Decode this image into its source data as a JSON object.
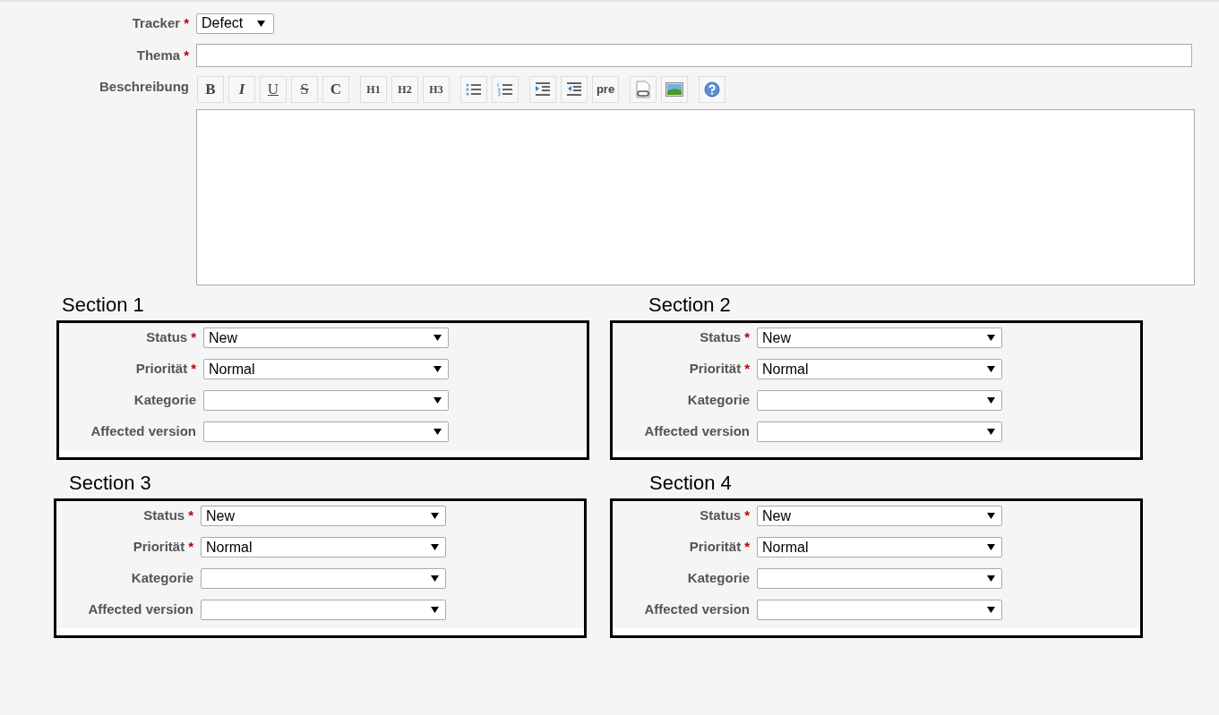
{
  "form": {
    "tracker": {
      "label": "Tracker",
      "mark": "*",
      "value": "Defect"
    },
    "subject": {
      "label": "Thema",
      "mark": "*"
    },
    "description": {
      "label": "Beschreibung",
      "toolbar": [
        [
          {
            "kind": "bold",
            "glyph": "B"
          },
          {
            "kind": "italic",
            "glyph": "I"
          },
          {
            "kind": "underline",
            "glyph": "U"
          },
          {
            "kind": "strike",
            "glyph": "S"
          },
          {
            "kind": "code",
            "glyph": "C"
          }
        ],
        [
          {
            "kind": "heading",
            "glyph": "H1"
          },
          {
            "kind": "heading",
            "glyph": "H2"
          },
          {
            "kind": "heading",
            "glyph": "H3"
          }
        ],
        [
          {
            "kind": "bullet-list"
          },
          {
            "kind": "numbered-list"
          }
        ],
        [
          {
            "kind": "indent-right"
          },
          {
            "kind": "indent-left"
          },
          {
            "kind": "pre",
            "glyph": "pre"
          }
        ],
        [
          {
            "kind": "link"
          },
          {
            "kind": "image"
          }
        ],
        [
          {
            "kind": "help"
          }
        ]
      ]
    }
  },
  "sections": [
    {
      "title": "Section 1",
      "fields": [
        {
          "label": "Status",
          "mark": "*",
          "value": "New"
        },
        {
          "label": "Priorität",
          "mark": "*",
          "value": "Normal"
        },
        {
          "label": "Kategorie"
        },
        {
          "label": "Affected version"
        }
      ]
    },
    {
      "title": "Section 2",
      "fields": [
        {
          "label": "Status",
          "mark": "*",
          "value": "New"
        },
        {
          "label": "Priorität",
          "mark": "*",
          "value": "Normal"
        },
        {
          "label": "Kategorie"
        },
        {
          "label": "Affected version"
        }
      ]
    },
    {
      "title": "Section 3",
      "fields": [
        {
          "label": "Status",
          "mark": "*",
          "value": "New"
        },
        {
          "label": "Priorität",
          "mark": "*",
          "value": "Normal"
        },
        {
          "label": "Kategorie"
        },
        {
          "label": "Affected version"
        }
      ]
    },
    {
      "title": "Section 4",
      "fields": [
        {
          "label": "Status",
          "mark": "*",
          "value": "New"
        },
        {
          "label": "Priorität",
          "mark": "*",
          "value": "Normal"
        },
        {
          "label": "Kategorie"
        },
        {
          "label": "Affected version"
        }
      ]
    }
  ]
}
